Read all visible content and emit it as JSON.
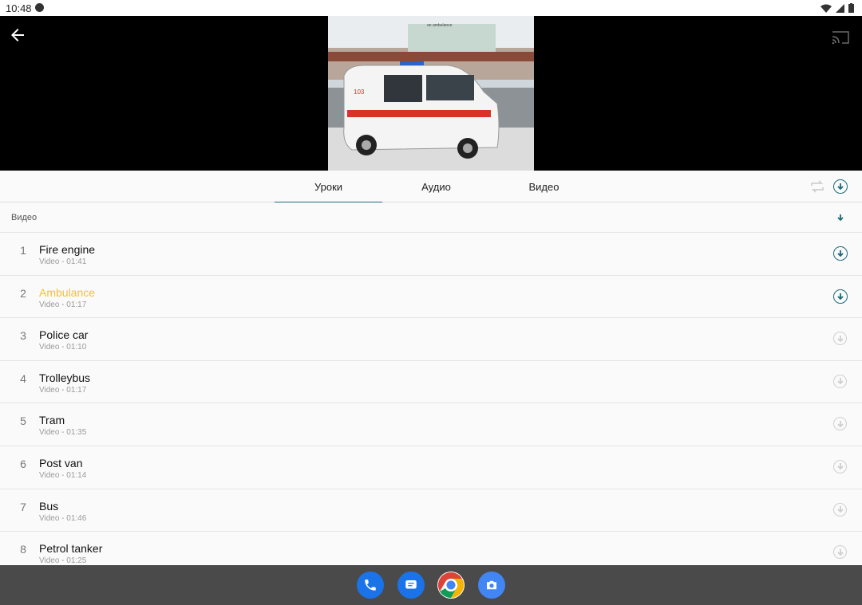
{
  "status_bar": {
    "time": "10:48"
  },
  "video": {
    "banner_text": "an ambulance",
    "plate": "103"
  },
  "tabs": [
    {
      "label": "Уроки",
      "active": true
    },
    {
      "label": "Аудио",
      "active": false
    },
    {
      "label": "Видео",
      "active": false
    }
  ],
  "section": {
    "label": "Видео"
  },
  "items": [
    {
      "num": "1",
      "title": "Fire engine",
      "meta": "Video - 01:41",
      "downloadable": true,
      "current": false
    },
    {
      "num": "2",
      "title": "Ambulance",
      "meta": "Video - 01:17",
      "downloadable": true,
      "current": true
    },
    {
      "num": "3",
      "title": "Police car",
      "meta": "Video - 01:10",
      "downloadable": false,
      "current": false
    },
    {
      "num": "4",
      "title": "Trolleybus",
      "meta": "Video - 01:17",
      "downloadable": false,
      "current": false
    },
    {
      "num": "5",
      "title": "Tram",
      "meta": "Video - 01:35",
      "downloadable": false,
      "current": false
    },
    {
      "num": "6",
      "title": "Post van",
      "meta": "Video - 01:14",
      "downloadable": false,
      "current": false
    },
    {
      "num": "7",
      "title": "Bus",
      "meta": "Video - 01:46",
      "downloadable": false,
      "current": false
    },
    {
      "num": "8",
      "title": "Petrol tanker",
      "meta": "Video - 01:25",
      "downloadable": false,
      "current": false
    }
  ],
  "colors": {
    "accent": "#1b6b78",
    "current_item": "#f5c12e",
    "nav_background": "#4a4a4a"
  },
  "dock_apps": [
    "phone-icon",
    "messages-icon",
    "chrome-icon",
    "camera-icon"
  ]
}
